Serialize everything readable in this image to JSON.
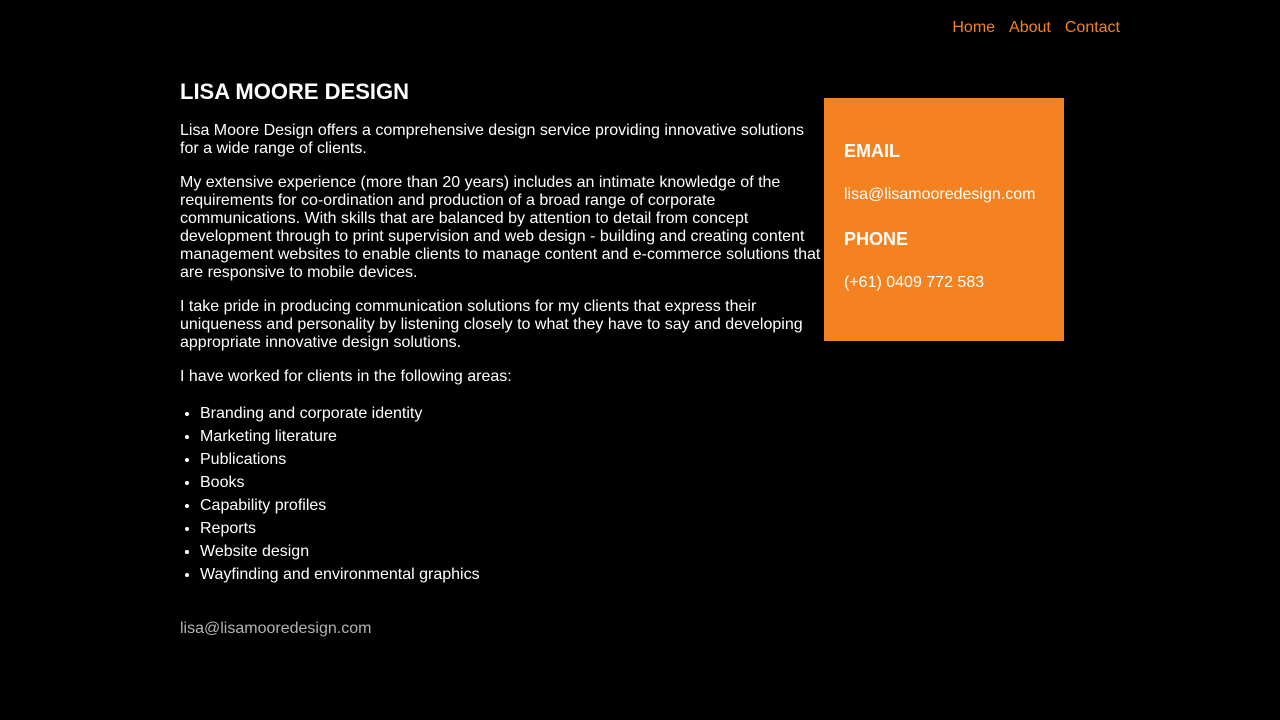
{
  "nav": {
    "items": [
      {
        "label": "Home"
      },
      {
        "label": "About"
      },
      {
        "label": "Contact"
      }
    ]
  },
  "main": {
    "title": "LISA MOORE DESIGN",
    "paragraphs": [
      "Lisa Moore Design offers a comprehensive design service providing innovative solutions for a wide range of clients.",
      "My extensive experience (more than 20 years) includes an intimate knowledge of the requirements for co-ordination and production of a broad range of corporate communications. With skills that are balanced by attention to detail from concept development through to print supervision and web design - building and creating content management websites to enable clients to manage content and e-commerce solutions that are responsive to mobile devices.",
      "I take pride in producing communication solutions for my clients that express their uniqueness and personality by listening closely to what they have to say and developing appropriate innovative design solutions.",
      "I have worked for clients in the following areas:"
    ],
    "services": [
      "Branding and corporate identity",
      "Marketing literature",
      "Publications",
      "Books",
      "Capability profiles",
      "Reports",
      "Website design",
      "Wayfinding and environmental graphics"
    ]
  },
  "contact": {
    "email_heading": "EMAIL",
    "email": "lisa@lisamooredesign.com",
    "phone_heading": "PHONE",
    "phone": "(+61) 0409 772 583"
  },
  "footer": {
    "email": "lisa@lisamooredesign.com"
  },
  "colors": {
    "accent": "#f58220",
    "background": "#000000",
    "text": "#ffffff",
    "footer_text": "#b3b3b3"
  }
}
